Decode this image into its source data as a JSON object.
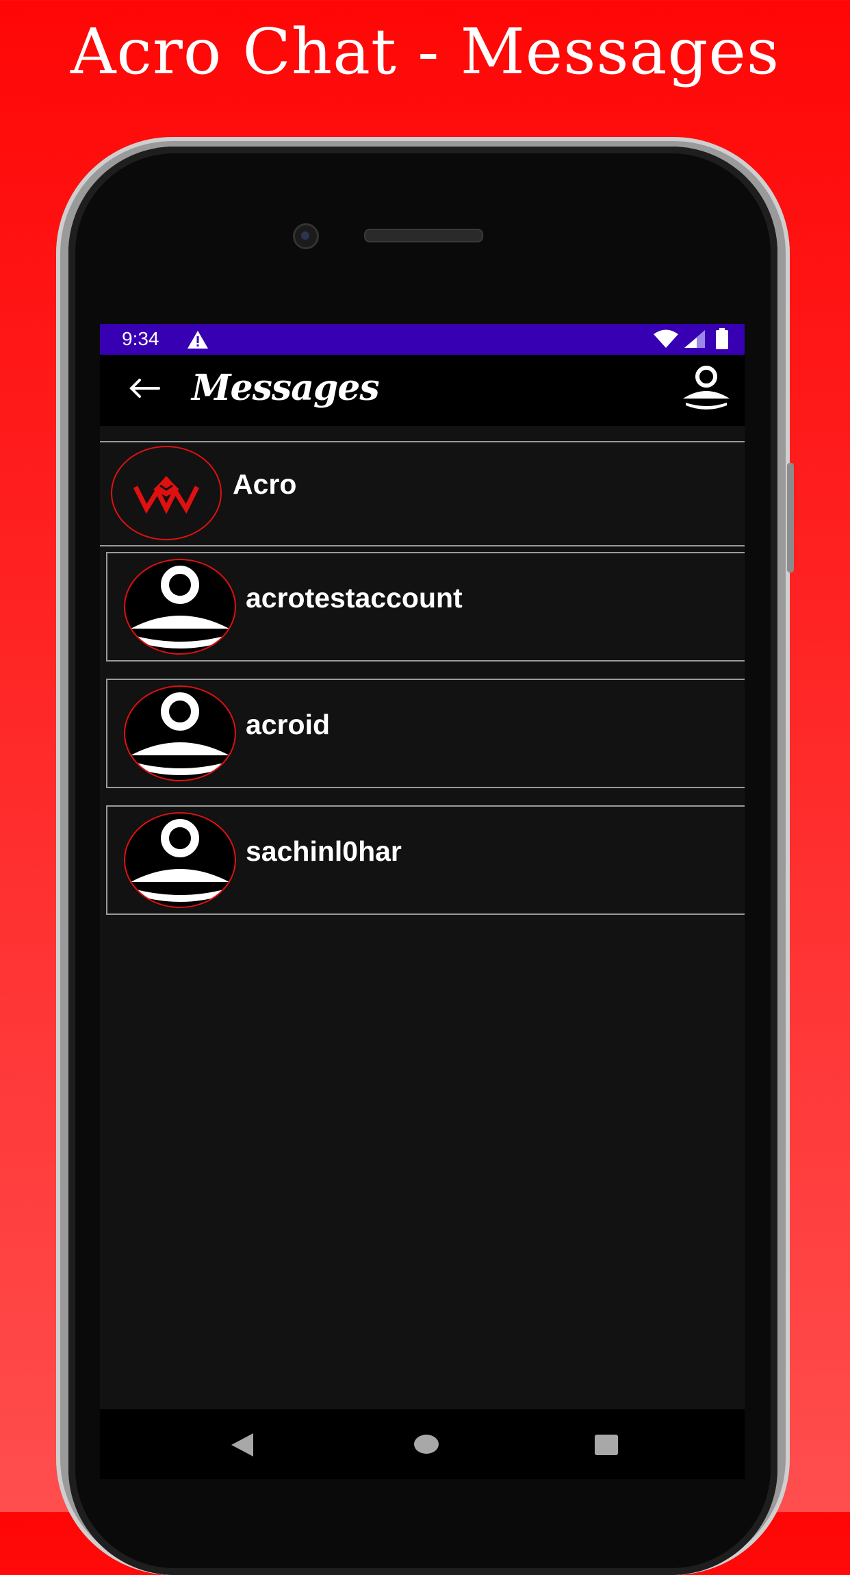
{
  "promo": {
    "title": "Acro Chat - Messages"
  },
  "status_bar": {
    "time": "9:34"
  },
  "app_bar": {
    "title": "Messages"
  },
  "header_contact": {
    "name": "Acro"
  },
  "contacts": [
    {
      "name": "acrotestaccount"
    },
    {
      "name": "acroid"
    },
    {
      "name": "sachinl0har"
    }
  ],
  "colors": {
    "status_bar": "#3700b3",
    "accent_red": "#e01010",
    "screen_bg": "#121212"
  },
  "icons": [
    "warning-icon",
    "wifi-icon",
    "signal-icon",
    "battery-icon",
    "back-arrow-icon",
    "profile-icon",
    "acro-logo-icon",
    "user-avatar-icon",
    "nav-back-icon",
    "nav-home-icon",
    "nav-recents-icon"
  ]
}
